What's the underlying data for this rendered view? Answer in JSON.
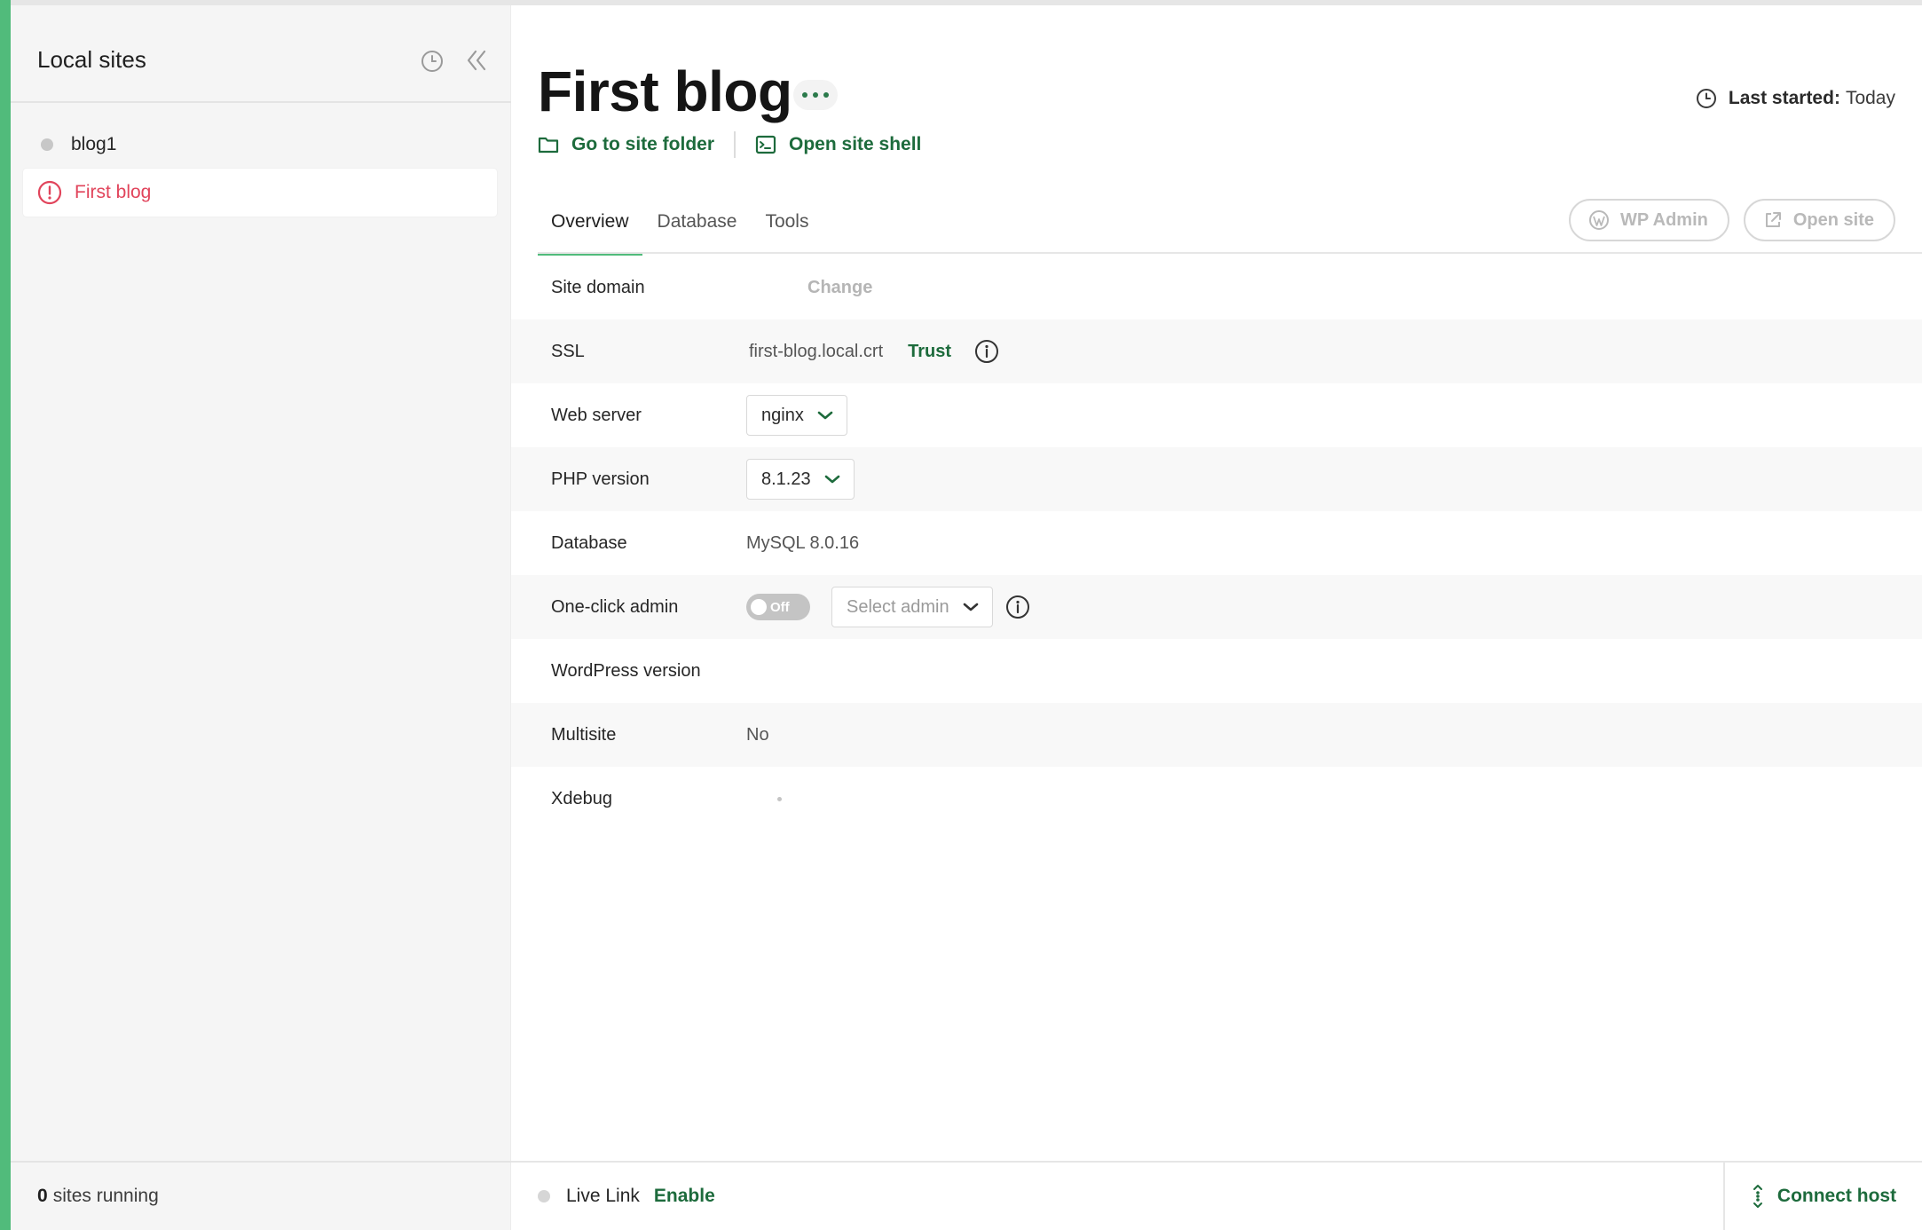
{
  "sidebar": {
    "title": "Local sites",
    "history_icon": "clock-icon",
    "collapse_icon": "double-chevron-left-icon",
    "sites": [
      {
        "name": "blog1",
        "status": "stopped"
      },
      {
        "name": "First blog",
        "status": "error",
        "active": true
      }
    ],
    "footer": {
      "count": "0",
      "label": "sites running"
    }
  },
  "site": {
    "title": "First blog",
    "last_started_label": "Last started",
    "last_started_value": "Today",
    "go_to_folder": "Go to site folder",
    "open_shell": "Open site shell"
  },
  "tabs": [
    {
      "label": "Overview",
      "active": true
    },
    {
      "label": "Database"
    },
    {
      "label": "Tools"
    }
  ],
  "header_buttons": {
    "wp_admin": "WP Admin",
    "open_site": "Open site"
  },
  "overview": {
    "site_domain": {
      "label": "Site domain",
      "action": "Change"
    },
    "ssl": {
      "label": "SSL",
      "value": "first-blog.local.crt",
      "action": "Trust"
    },
    "web_server": {
      "label": "Web server",
      "value": "nginx"
    },
    "php_version": {
      "label": "PHP version",
      "value": "8.1.23"
    },
    "database": {
      "label": "Database",
      "value": "MySQL 8.0.16"
    },
    "one_click_admin": {
      "label": "One-click admin",
      "toggle": "Off",
      "select_placeholder": "Select admin"
    },
    "wordpress_version": {
      "label": "WordPress version"
    },
    "multisite": {
      "label": "Multisite",
      "value": "No"
    },
    "xdebug": {
      "label": "Xdebug"
    }
  },
  "footer": {
    "live_link_label": "Live Link",
    "enable": "Enable",
    "connect_host": "Connect host"
  },
  "colors": {
    "accent": "#51bb7b",
    "link_green": "#1d6b3c",
    "error_red": "#e1445b"
  }
}
